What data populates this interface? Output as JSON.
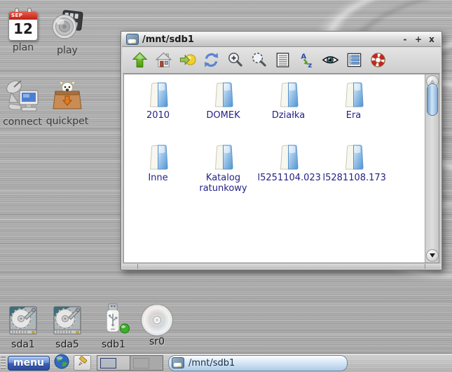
{
  "desktop": {
    "icons": [
      {
        "id": "plan",
        "label": "plan"
      },
      {
        "id": "play",
        "label": "play"
      },
      {
        "id": "connect",
        "label": "connect"
      },
      {
        "id": "quickpet",
        "label": "quickpet"
      }
    ],
    "calendar": {
      "month": "SEP",
      "day": "12"
    },
    "drives": [
      {
        "id": "sda1",
        "label": "sda1",
        "type": "harddisk"
      },
      {
        "id": "sda5",
        "label": "sda5",
        "type": "harddisk"
      },
      {
        "id": "sdb1",
        "label": "sdb1",
        "type": "usb",
        "mounted": true
      },
      {
        "id": "sr0",
        "label": "sr0",
        "type": "cd"
      }
    ]
  },
  "window": {
    "title": "/mnt/sdb1",
    "controls": [
      {
        "name": "minimize",
        "glyph": "-"
      },
      {
        "name": "maximize",
        "glyph": "+"
      },
      {
        "name": "close",
        "glyph": "x"
      }
    ],
    "toolbar": [
      {
        "name": "up"
      },
      {
        "name": "home"
      },
      {
        "name": "bookmarks"
      },
      {
        "name": "refresh"
      },
      {
        "name": "zoom-in"
      },
      {
        "name": "resize-fit"
      },
      {
        "name": "list-view"
      },
      {
        "name": "sort"
      },
      {
        "name": "show-hidden"
      },
      {
        "name": "details"
      },
      {
        "name": "help"
      }
    ],
    "folders": [
      "2010",
      "DOMEK",
      "Działka",
      "Era",
      "Inne",
      "Katalog ratunkowy",
      "l5251104.023",
      "l5281108.173"
    ]
  },
  "taskbar": {
    "menu_label": "menu",
    "task_button_label": "/mnt/sdb1",
    "desktops": 2,
    "current_desktop": 1
  },
  "colors": {
    "folder_blue": "#4f94d4",
    "folder_label": "#232388",
    "menu_blue": "#2d4b9c",
    "task_button_blue": "#aecbe6",
    "scroll_thumb_blue": "#a5c6e5"
  }
}
